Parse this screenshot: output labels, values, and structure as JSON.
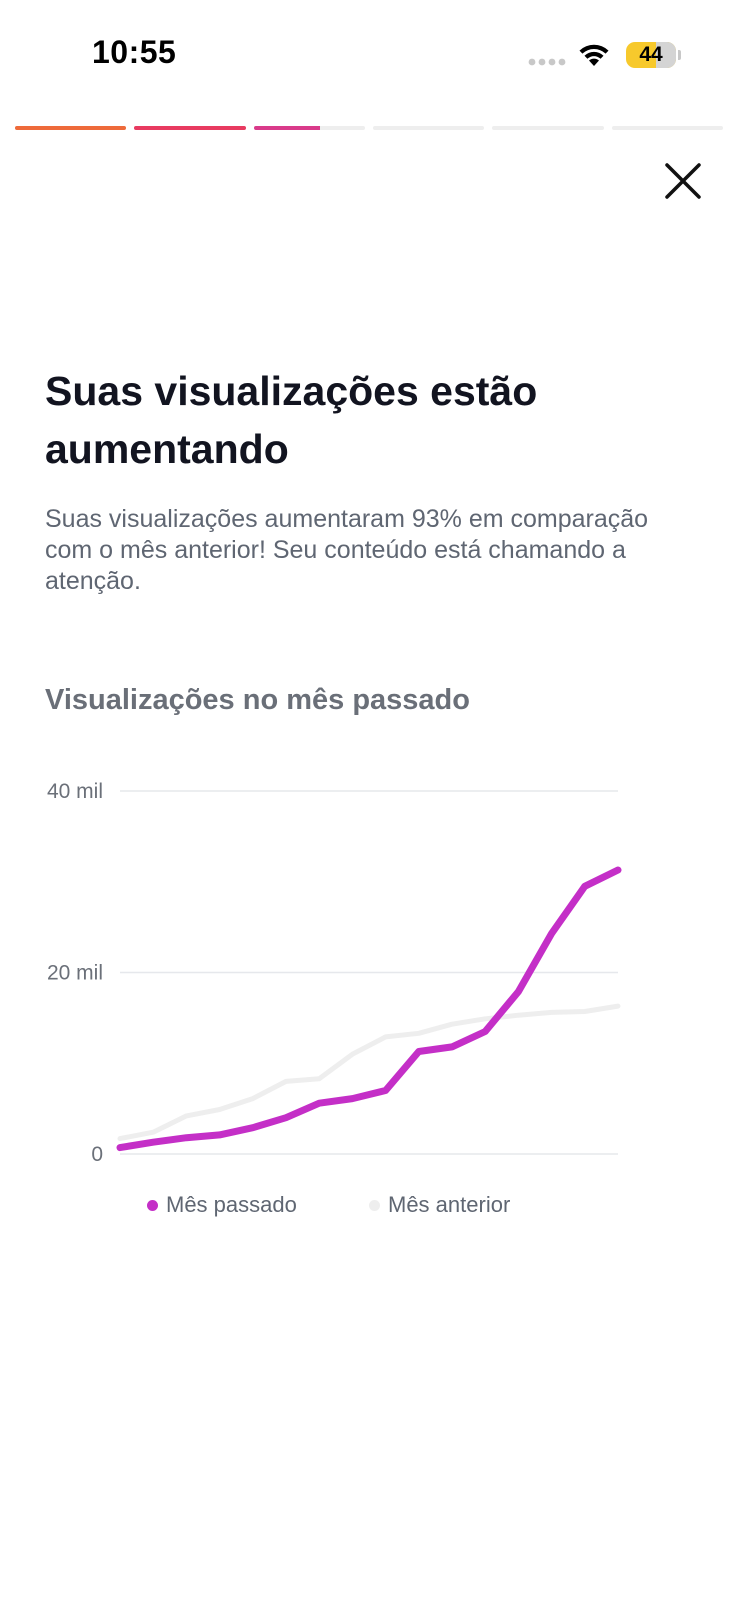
{
  "status_bar": {
    "time": "10:55",
    "battery": "44",
    "icons": [
      "cellular-signal-icon",
      "wifi-icon",
      "battery-icon"
    ]
  },
  "story_progress": {
    "segments": [
      {
        "fill": 1.0,
        "color": "#ee6a3a"
      },
      {
        "fill": 1.0,
        "color": "#e83a60"
      },
      {
        "fill": 0.6,
        "color": "#d93a8a"
      },
      {
        "fill": 0.0,
        "color": "#eeeeee"
      },
      {
        "fill": 0.0,
        "color": "#eeeeee"
      },
      {
        "fill": 0.0,
        "color": "#eeeeee"
      }
    ]
  },
  "header": {
    "close_icon": "close-icon"
  },
  "content": {
    "title": "Suas visualizações estão aumentando",
    "description": "Suas visualizações aumentaram 93% em comparação com o mês anterior! Seu conteúdo está chamando a atenção.",
    "chart_heading": "Visualizações no mês passado"
  },
  "chart_data": {
    "type": "line",
    "y_ticks": [
      {
        "value": 0,
        "label": "0"
      },
      {
        "value": 20000,
        "label": "20 mil"
      },
      {
        "value": 40000,
        "label": "40 mil"
      }
    ],
    "ylim": [
      0,
      40000
    ],
    "x": [
      1,
      2,
      3,
      4,
      5,
      6,
      7,
      8,
      9,
      10,
      11,
      12,
      13,
      14,
      15,
      16
    ],
    "grid": true,
    "legend_position": "bottom",
    "series": [
      {
        "name": "Mês passado",
        "color": "#c42fc7",
        "values": [
          700,
          1300,
          1800,
          2100,
          2900,
          4000,
          5600,
          6100,
          7000,
          11300,
          11800,
          13500,
          17900,
          24300,
          29500,
          31300
        ]
      },
      {
        "name": "Mês anterior",
        "color": "#eeeeee",
        "values": [
          1700,
          2400,
          4200,
          4900,
          6100,
          8000,
          8300,
          11000,
          12900,
          13300,
          14300,
          14900,
          15300,
          15600,
          15700,
          16300
        ]
      }
    ]
  }
}
